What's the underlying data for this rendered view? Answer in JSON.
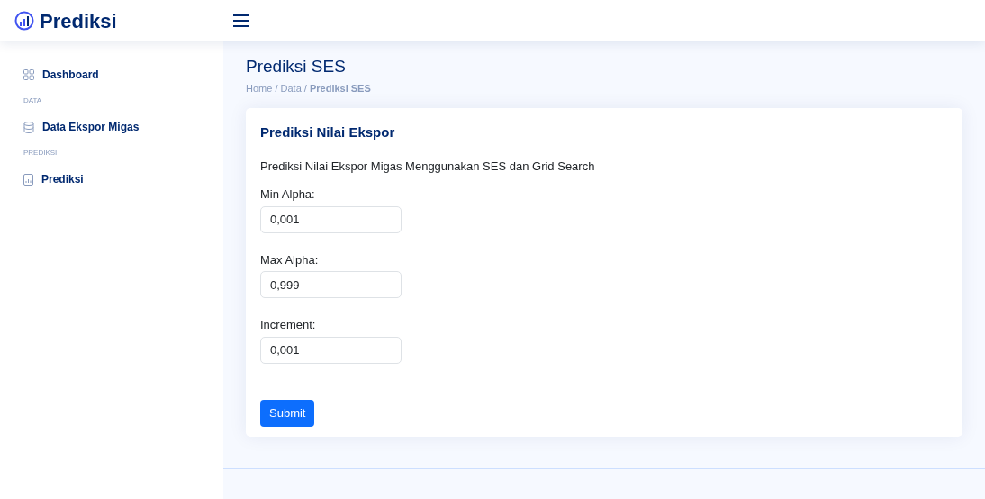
{
  "brand": "Prediksi",
  "sidebar": {
    "items": [
      {
        "kind": "link",
        "label": "Dashboard"
      },
      {
        "kind": "heading",
        "label": "DATA"
      },
      {
        "kind": "link",
        "label": "Data Ekspor Migas"
      },
      {
        "kind": "heading",
        "label": "PREDIKSI"
      },
      {
        "kind": "link",
        "label": "Prediksi"
      }
    ]
  },
  "page": {
    "title": "Prediksi SES",
    "breadcrumb": "Home / Data / **Prediksi SES**"
  },
  "card": {
    "title": "Prediksi Nilai Ekspor",
    "description": "Prediksi Nilai Ekspor Migas Menggunakan SES dan Grid Search",
    "fields": [
      {
        "label": "Min Alpha:",
        "value": "0,001"
      },
      {
        "label": "Max Alpha:",
        "value": "0,999"
      },
      {
        "label": "Increment:",
        "value": "0,001"
      }
    ],
    "submit": "Submit"
  }
}
